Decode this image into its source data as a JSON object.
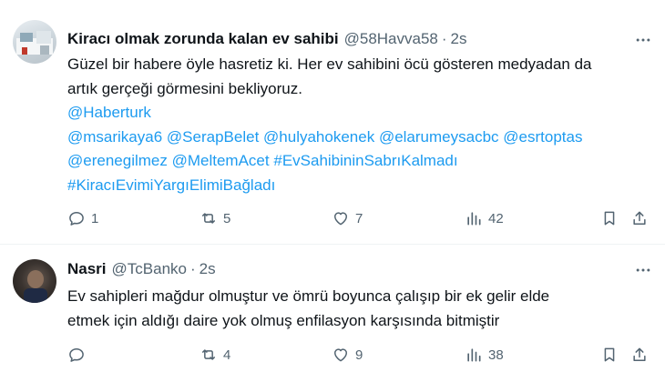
{
  "tweets": [
    {
      "name": "Kiracı olmak zorunda kalan ev sahibi",
      "handle": "@58Havva58",
      "time": "2s",
      "text_lines": [
        "Güzel bir habere öyle hasretiz ki. Her ev sahibini öcü gösteren medyadan da",
        "artık gerçeği görmesini bekliyoruz."
      ],
      "mention_line_1": "@Haberturk",
      "mention_line_2": [
        "@msarikaya6",
        "@SerapBelet",
        "@hulyahokenek",
        "@elarumeysacbc",
        "@esrtoptas"
      ],
      "mention_line_3": [
        "@erenegilmez",
        "@MeltemAcet",
        "#EvSahibininSabrıKalmadı"
      ],
      "mention_line_4": [
        "#KiracıEvimiYargıElimiBağladı"
      ],
      "replies": "1",
      "retweets": "5",
      "likes": "7",
      "views": "42"
    },
    {
      "name": "Nasri",
      "handle": "@TcBanko",
      "time": "2s",
      "text_lines": [
        "Ev sahipleri mağdur olmuştur ve ömrü boyunca çalışıp bir ek gelir elde",
        "etmek için aldığı daire yok olmuş enfilasyon karşısında bitmiştir"
      ],
      "replies": "",
      "retweets": "4",
      "likes": "9",
      "views": "38"
    }
  ],
  "icons": {
    "more": "more-icon",
    "reply": "reply-icon",
    "retweet": "retweet-icon",
    "like": "like-icon",
    "views": "views-icon",
    "bookmark": "bookmark-icon",
    "share": "share-icon"
  },
  "colors": {
    "text": "#0f1419",
    "secondary": "#536471",
    "link": "#1d9bf0",
    "divider": "#eff3f4"
  }
}
